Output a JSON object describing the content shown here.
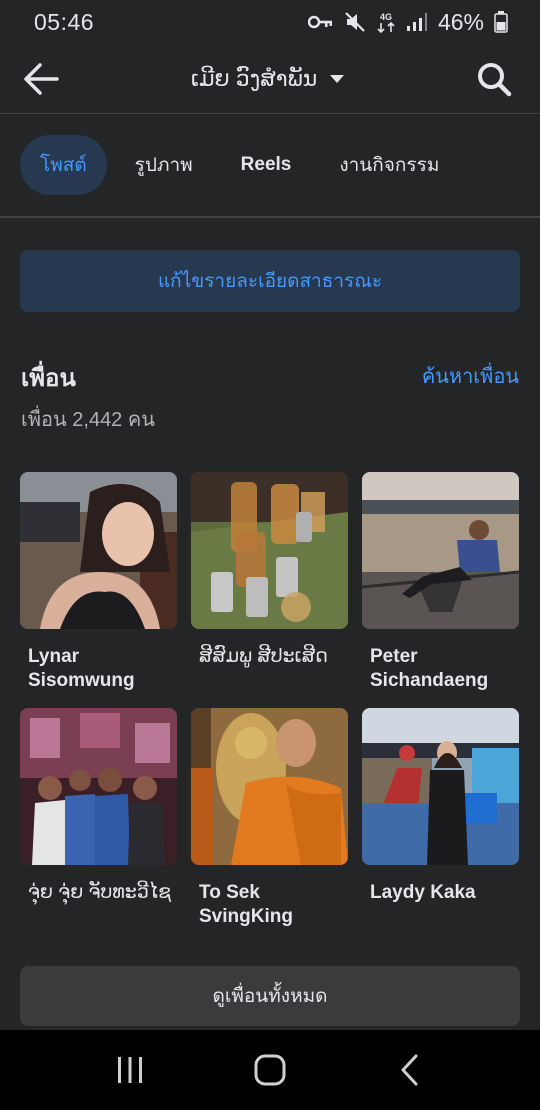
{
  "status": {
    "time": "05:46",
    "network": "4G",
    "battery": "46%"
  },
  "header": {
    "title": "ເມີຍ ວົງສຳພັນ"
  },
  "tabs": [
    {
      "label": "โพสต์",
      "active": true
    },
    {
      "label": "รูปภาพ",
      "active": false
    },
    {
      "label": "Reels",
      "active": false
    },
    {
      "label": "งานกิจกรรม",
      "active": false
    }
  ],
  "edit_button": "แก้ไขรายละเอียดสาธารณะ",
  "friends": {
    "title": "เพื่อน",
    "find_link": "ค้นหาเพื่อน",
    "count": "เพื่อน 2,442 คน",
    "items": [
      {
        "name": "Lynar Sisomwung"
      },
      {
        "name": "ສີສົມພູ ສີປະເສີດ"
      },
      {
        "name": "Peter Sichandaeng"
      },
      {
        "name": "ຈຸ່ຍ ຈຸ່ຍ ຈັບທະວີໄຊ"
      },
      {
        "name": "To Sek SvingKing"
      },
      {
        "name": "Laydy Kaka"
      }
    ],
    "see_all": "ดูเพื่อนทั้งหมด"
  },
  "colors": {
    "background": "#242526",
    "accent": "#4599ff",
    "accent_bg": "#263951"
  }
}
